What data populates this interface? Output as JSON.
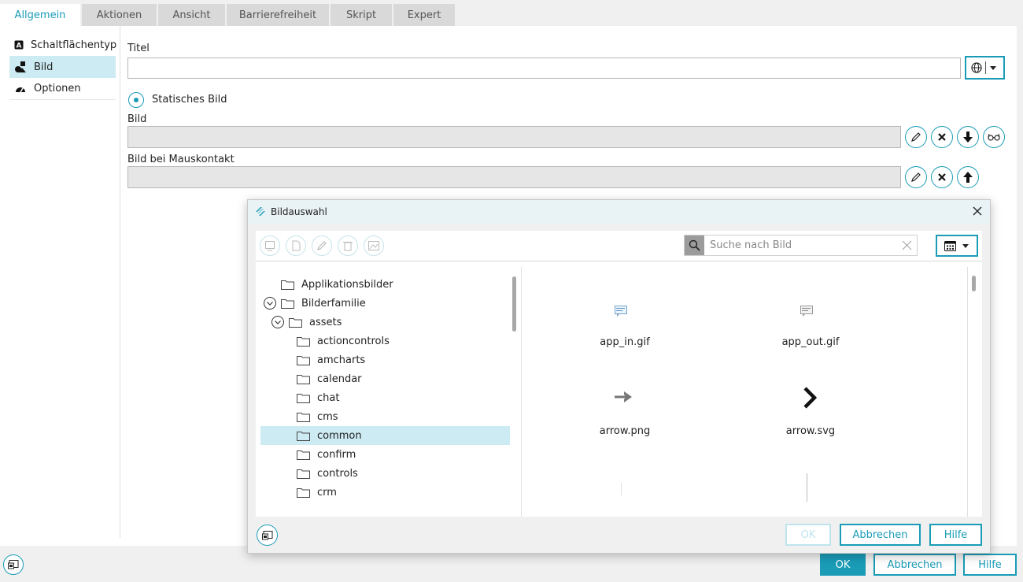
{
  "tabs": [
    {
      "label": "Allgemein",
      "active": true
    },
    {
      "label": "Aktionen",
      "active": false
    },
    {
      "label": "Ansicht",
      "active": false
    },
    {
      "label": "Barrierefreiheit",
      "active": false
    },
    {
      "label": "Skript",
      "active": false
    },
    {
      "label": "Expert",
      "active": false
    }
  ],
  "sidebar": {
    "items": [
      {
        "label": "Schaltflächentyp",
        "icon": "button-type-icon"
      },
      {
        "label": "Bild",
        "icon": "image-shapes-icon",
        "active": true
      },
      {
        "label": "Optionen",
        "icon": "dashboard-icon"
      }
    ]
  },
  "form": {
    "title_label": "Titel",
    "title_value": "",
    "static_image_label": "Statisches Bild",
    "image_label": "Bild",
    "image_value": "",
    "hover_image_label": "Bild bei Mauskontakt",
    "hover_image_value": ""
  },
  "dialog": {
    "title": "Bildauswahl",
    "search_placeholder": "Suche nach Bild",
    "tree": [
      {
        "label": "Applikationsbilder",
        "level": 0,
        "expanded": null
      },
      {
        "label": "Bilderfamilie",
        "level": 0,
        "expanded": true
      },
      {
        "label": "assets",
        "level": 1,
        "expanded": true
      },
      {
        "label": "actioncontrols",
        "level": 2
      },
      {
        "label": "amcharts",
        "level": 2
      },
      {
        "label": "calendar",
        "level": 2
      },
      {
        "label": "chat",
        "level": 2
      },
      {
        "label": "cms",
        "level": 2
      },
      {
        "label": "common",
        "level": 2,
        "selected": true
      },
      {
        "label": "confirm",
        "level": 2
      },
      {
        "label": "controls",
        "level": 2
      },
      {
        "label": "crm",
        "level": 2
      }
    ],
    "files": [
      {
        "name": "app_in.gif"
      },
      {
        "name": "app_out.gif"
      },
      {
        "name": "arrow.png"
      },
      {
        "name": "arrow.svg"
      }
    ],
    "ok_label": "OK",
    "cancel_label": "Abbrechen",
    "help_label": "Hilfe"
  },
  "footer": {
    "ok_label": "OK",
    "cancel_label": "Abbrechen",
    "help_label": "Hilfe"
  },
  "colors": {
    "accent": "#1a9cb7",
    "selection": "#cdebf3"
  }
}
